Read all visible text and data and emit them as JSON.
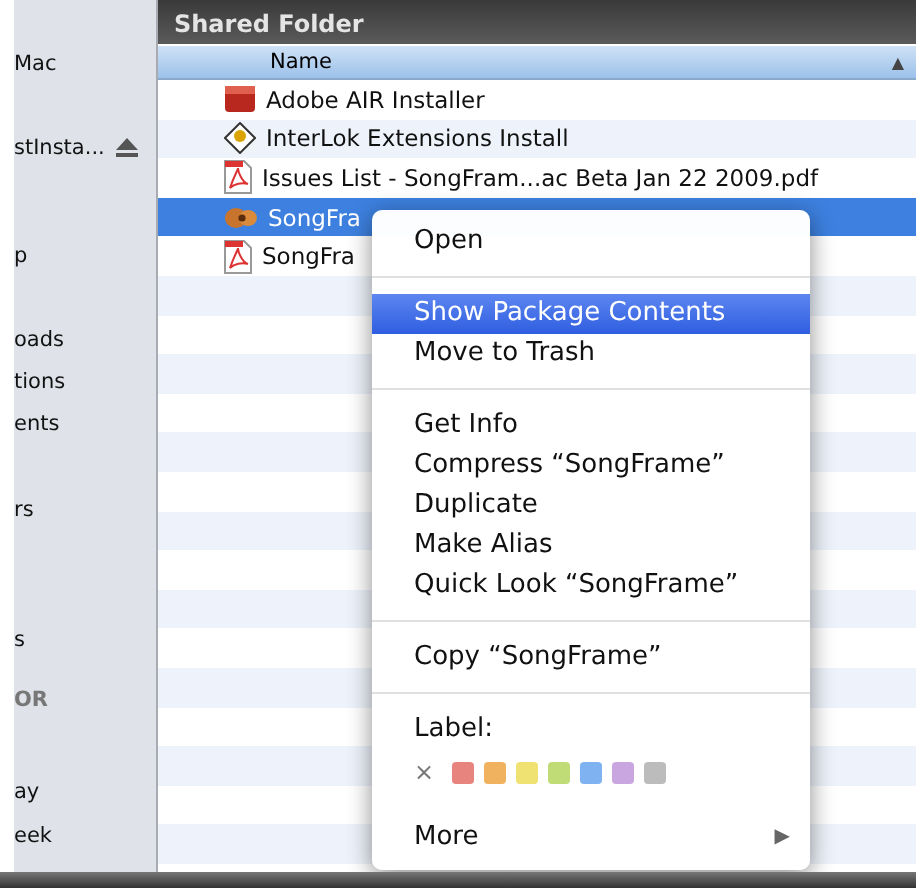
{
  "window": {
    "title": "Shared Folder"
  },
  "sidebar": {
    "items": [
      {
        "label": "Mac",
        "kind": "item"
      },
      {
        "label": "stInsta...",
        "kind": "eject"
      },
      {
        "label": "p",
        "kind": "item"
      },
      {
        "label": "oads",
        "kind": "item"
      },
      {
        "label": "tions",
        "kind": "item"
      },
      {
        "label": "ents",
        "kind": "item"
      },
      {
        "label": "rs",
        "kind": "item"
      },
      {
        "label": "s",
        "kind": "item"
      },
      {
        "label": "OR",
        "kind": "header"
      },
      {
        "label": "ay",
        "kind": "item"
      },
      {
        "label": "eek",
        "kind": "item"
      }
    ]
  },
  "table": {
    "columns": [
      {
        "label": "Name",
        "sort_arrow": "▲"
      }
    ],
    "rows": [
      {
        "name": "Adobe AIR Installer",
        "kind": "installer",
        "selected": false
      },
      {
        "name": "InterLok Extensions Install",
        "kind": "extension",
        "selected": false
      },
      {
        "name": "Issues List - SongFram...ac Beta Jan 22 2009.pdf",
        "kind": "pdf",
        "selected": false
      },
      {
        "name": "SongFra",
        "kind": "app",
        "selected": true
      },
      {
        "name": "SongFra",
        "kind": "pdf",
        "selected": false
      }
    ]
  },
  "context_menu": {
    "groups": [
      {
        "items": [
          {
            "label": "Open",
            "selected": false
          }
        ]
      },
      {
        "items": [
          {
            "label": "Show Package Contents",
            "selected": true
          },
          {
            "label": "Move to Trash",
            "selected": false
          }
        ]
      },
      {
        "items": [
          {
            "label": "Get Info",
            "selected": false
          },
          {
            "label": "Compress “SongFrame”",
            "selected": false
          },
          {
            "label": "Duplicate",
            "selected": false
          },
          {
            "label": "Make Alias",
            "selected": false
          },
          {
            "label": "Quick Look “SongFrame”",
            "selected": false
          }
        ]
      },
      {
        "items": [
          {
            "label": "Copy “SongFrame”",
            "selected": false
          }
        ]
      }
    ],
    "label_section": {
      "title": "Label:",
      "clear": "×",
      "colors": [
        {
          "color": "#e8847e"
        },
        {
          "color": "#f0b25e"
        },
        {
          "color": "#efe272"
        },
        {
          "color": "#bfdc77"
        },
        {
          "color": "#7fb2f0"
        },
        {
          "color": "#c9a6e0"
        },
        {
          "color": "#bcbcbc"
        }
      ]
    },
    "more": {
      "label": "More",
      "arrow": "▶"
    }
  }
}
